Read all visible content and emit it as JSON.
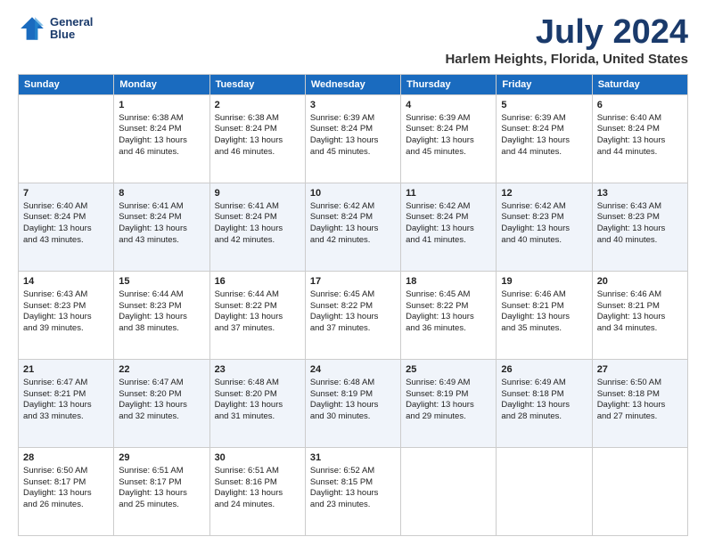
{
  "logo": {
    "line1": "General",
    "line2": "Blue"
  },
  "title": "July 2024",
  "subtitle": "Harlem Heights, Florida, United States",
  "headers": [
    "Sunday",
    "Monday",
    "Tuesday",
    "Wednesday",
    "Thursday",
    "Friday",
    "Saturday"
  ],
  "weeks": [
    [
      {
        "day": "",
        "info": ""
      },
      {
        "day": "1",
        "info": "Sunrise: 6:38 AM\nSunset: 8:24 PM\nDaylight: 13 hours\nand 46 minutes."
      },
      {
        "day": "2",
        "info": "Sunrise: 6:38 AM\nSunset: 8:24 PM\nDaylight: 13 hours\nand 46 minutes."
      },
      {
        "day": "3",
        "info": "Sunrise: 6:39 AM\nSunset: 8:24 PM\nDaylight: 13 hours\nand 45 minutes."
      },
      {
        "day": "4",
        "info": "Sunrise: 6:39 AM\nSunset: 8:24 PM\nDaylight: 13 hours\nand 45 minutes."
      },
      {
        "day": "5",
        "info": "Sunrise: 6:39 AM\nSunset: 8:24 PM\nDaylight: 13 hours\nand 44 minutes."
      },
      {
        "day": "6",
        "info": "Sunrise: 6:40 AM\nSunset: 8:24 PM\nDaylight: 13 hours\nand 44 minutes."
      }
    ],
    [
      {
        "day": "7",
        "info": "Sunrise: 6:40 AM\nSunset: 8:24 PM\nDaylight: 13 hours\nand 43 minutes."
      },
      {
        "day": "8",
        "info": "Sunrise: 6:41 AM\nSunset: 8:24 PM\nDaylight: 13 hours\nand 43 minutes."
      },
      {
        "day": "9",
        "info": "Sunrise: 6:41 AM\nSunset: 8:24 PM\nDaylight: 13 hours\nand 42 minutes."
      },
      {
        "day": "10",
        "info": "Sunrise: 6:42 AM\nSunset: 8:24 PM\nDaylight: 13 hours\nand 42 minutes."
      },
      {
        "day": "11",
        "info": "Sunrise: 6:42 AM\nSunset: 8:24 PM\nDaylight: 13 hours\nand 41 minutes."
      },
      {
        "day": "12",
        "info": "Sunrise: 6:42 AM\nSunset: 8:23 PM\nDaylight: 13 hours\nand 40 minutes."
      },
      {
        "day": "13",
        "info": "Sunrise: 6:43 AM\nSunset: 8:23 PM\nDaylight: 13 hours\nand 40 minutes."
      }
    ],
    [
      {
        "day": "14",
        "info": "Sunrise: 6:43 AM\nSunset: 8:23 PM\nDaylight: 13 hours\nand 39 minutes."
      },
      {
        "day": "15",
        "info": "Sunrise: 6:44 AM\nSunset: 8:23 PM\nDaylight: 13 hours\nand 38 minutes."
      },
      {
        "day": "16",
        "info": "Sunrise: 6:44 AM\nSunset: 8:22 PM\nDaylight: 13 hours\nand 37 minutes."
      },
      {
        "day": "17",
        "info": "Sunrise: 6:45 AM\nSunset: 8:22 PM\nDaylight: 13 hours\nand 37 minutes."
      },
      {
        "day": "18",
        "info": "Sunrise: 6:45 AM\nSunset: 8:22 PM\nDaylight: 13 hours\nand 36 minutes."
      },
      {
        "day": "19",
        "info": "Sunrise: 6:46 AM\nSunset: 8:21 PM\nDaylight: 13 hours\nand 35 minutes."
      },
      {
        "day": "20",
        "info": "Sunrise: 6:46 AM\nSunset: 8:21 PM\nDaylight: 13 hours\nand 34 minutes."
      }
    ],
    [
      {
        "day": "21",
        "info": "Sunrise: 6:47 AM\nSunset: 8:21 PM\nDaylight: 13 hours\nand 33 minutes."
      },
      {
        "day": "22",
        "info": "Sunrise: 6:47 AM\nSunset: 8:20 PM\nDaylight: 13 hours\nand 32 minutes."
      },
      {
        "day": "23",
        "info": "Sunrise: 6:48 AM\nSunset: 8:20 PM\nDaylight: 13 hours\nand 31 minutes."
      },
      {
        "day": "24",
        "info": "Sunrise: 6:48 AM\nSunset: 8:19 PM\nDaylight: 13 hours\nand 30 minutes."
      },
      {
        "day": "25",
        "info": "Sunrise: 6:49 AM\nSunset: 8:19 PM\nDaylight: 13 hours\nand 29 minutes."
      },
      {
        "day": "26",
        "info": "Sunrise: 6:49 AM\nSunset: 8:18 PM\nDaylight: 13 hours\nand 28 minutes."
      },
      {
        "day": "27",
        "info": "Sunrise: 6:50 AM\nSunset: 8:18 PM\nDaylight: 13 hours\nand 27 minutes."
      }
    ],
    [
      {
        "day": "28",
        "info": "Sunrise: 6:50 AM\nSunset: 8:17 PM\nDaylight: 13 hours\nand 26 minutes."
      },
      {
        "day": "29",
        "info": "Sunrise: 6:51 AM\nSunset: 8:17 PM\nDaylight: 13 hours\nand 25 minutes."
      },
      {
        "day": "30",
        "info": "Sunrise: 6:51 AM\nSunset: 8:16 PM\nDaylight: 13 hours\nand 24 minutes."
      },
      {
        "day": "31",
        "info": "Sunrise: 6:52 AM\nSunset: 8:15 PM\nDaylight: 13 hours\nand 23 minutes."
      },
      {
        "day": "",
        "info": ""
      },
      {
        "day": "",
        "info": ""
      },
      {
        "day": "",
        "info": ""
      }
    ]
  ]
}
